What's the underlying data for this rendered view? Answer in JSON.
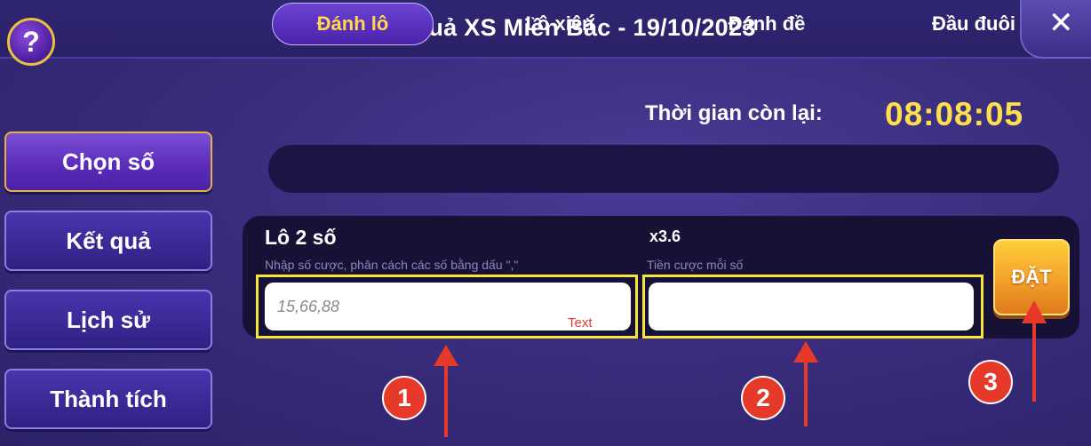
{
  "header": {
    "title": "Kết quả XS Miền Bắc - 19/10/2023",
    "help_label": "?",
    "close_label": "✕"
  },
  "sidebar": {
    "items": [
      {
        "label": "Chọn số",
        "active": true
      },
      {
        "label": "Kết quả",
        "active": false
      },
      {
        "label": "Lịch sử",
        "active": false
      },
      {
        "label": "Thành tích",
        "active": false
      }
    ]
  },
  "timer": {
    "label": "Thời gian còn lại:",
    "value": "08:08:05"
  },
  "tabs": [
    {
      "label": "Đánh lô",
      "active": true
    },
    {
      "label": "Lô xiên",
      "active": false
    },
    {
      "label": "Đánh đề",
      "active": false
    },
    {
      "label": "Đầu đuôi",
      "active": false
    }
  ],
  "bet": {
    "title": "Lô 2 số",
    "multiplier": "x3.6",
    "numbers_hint": "Nhập số cược, phân cách các số bằng dấu \",\"",
    "numbers_placeholder": "15,66,88",
    "amount_hint": "Tiền cược mỗi số",
    "amount_value": "",
    "submit_label": "ĐẶT"
  },
  "annotations": {
    "text_label": "Text",
    "step1": "1",
    "step2": "2",
    "step3": "3"
  },
  "colors": {
    "accent_yellow": "#ffe04a",
    "highlight": "#f5e63a",
    "arrow_red": "#e6392a"
  }
}
